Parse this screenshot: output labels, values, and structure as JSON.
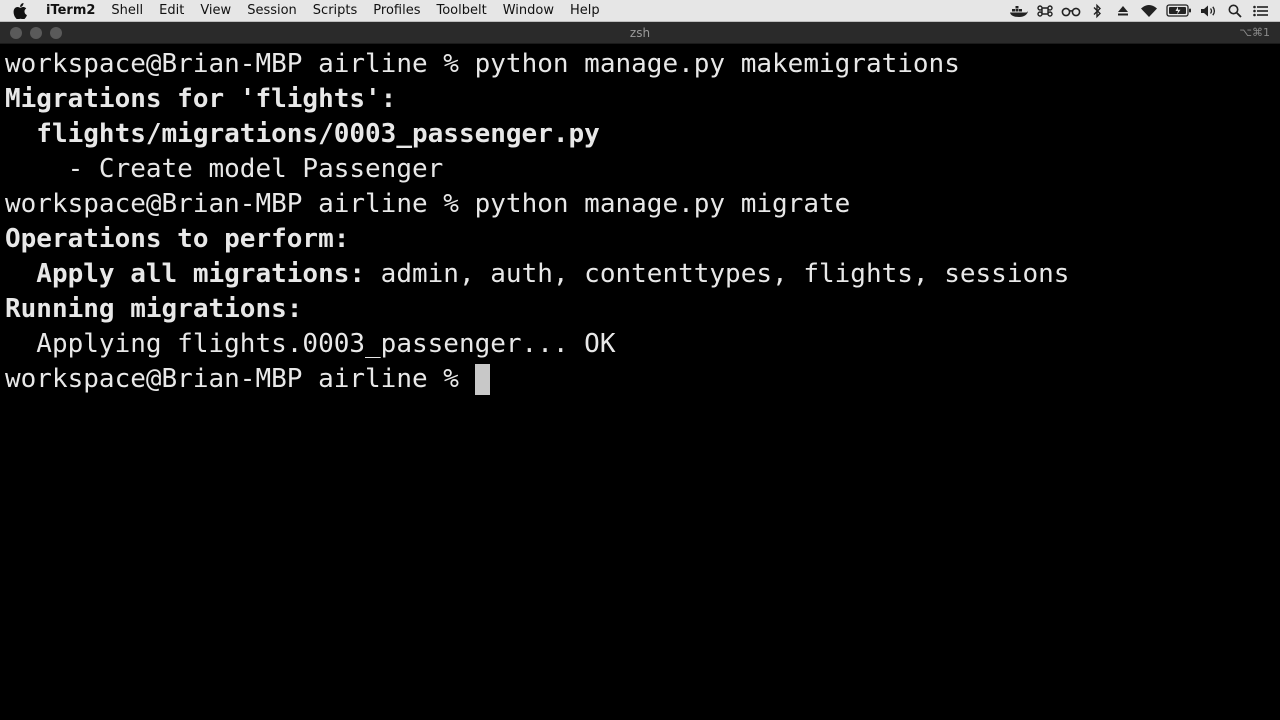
{
  "menubar": {
    "app_name": "iTerm2",
    "items": [
      "Shell",
      "Edit",
      "View",
      "Session",
      "Scripts",
      "Profiles",
      "Toolbelt",
      "Window",
      "Help"
    ],
    "status_icons": [
      "docker-icon",
      "command-icon",
      "glasses-icon",
      "bluetooth-icon",
      "eject-icon",
      "wifi-icon",
      "battery-icon",
      "volume-icon",
      "search-icon",
      "menu-list-icon"
    ]
  },
  "window": {
    "title": "zsh",
    "shortcut": "⌥⌘1"
  },
  "terminal": {
    "prompt": "workspace@Brian-MBP airline % ",
    "lines": [
      {
        "prompt": "workspace@Brian-MBP airline % ",
        "cmd": "python manage.py makemigrations"
      },
      {
        "bold": "Migrations for 'flights':",
        "rest": ""
      },
      {
        "bold": "  flights/migrations/0003_passenger.py",
        "rest": ""
      },
      {
        "text": "    - Create model Passenger"
      },
      {
        "prompt": "workspace@Brian-MBP airline % ",
        "cmd": "python manage.py migrate"
      },
      {
        "bold": "Operations to perform:",
        "rest": ""
      },
      {
        "bold": "  Apply all migrations:",
        "rest": " admin, auth, contenttypes, flights, sessions"
      },
      {
        "bold": "Running migrations:",
        "rest": ""
      },
      {
        "text": "  Applying flights.0003_passenger... OK"
      },
      {
        "prompt": "workspace@Brian-MBP airline % ",
        "cmd": ""
      }
    ]
  },
  "colors": {
    "terminal_bg": "#000000",
    "terminal_fg": "#e8e8e8",
    "cursor": "#c8c8c8",
    "menubar_bg": "#e6e6e6"
  }
}
